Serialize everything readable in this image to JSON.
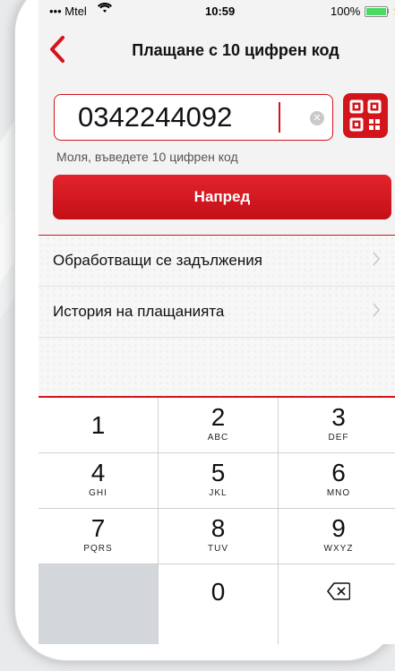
{
  "status": {
    "carrier": "••• Mtel",
    "time": "10:59",
    "battery": "100%"
  },
  "nav": {
    "title": "Плащане с 10 цифрен код"
  },
  "code_input": {
    "value": "0342244092"
  },
  "hint": "Моля, въведете 10 цифрен код",
  "next_button": "Напред",
  "list": [
    {
      "label": "Обработващи се задължения"
    },
    {
      "label": "История на плащанията"
    }
  ],
  "keypad": {
    "k1": {
      "num": "1",
      "letters": ""
    },
    "k2": {
      "num": "2",
      "letters": "ABC"
    },
    "k3": {
      "num": "3",
      "letters": "DEF"
    },
    "k4": {
      "num": "4",
      "letters": "GHI"
    },
    "k5": {
      "num": "5",
      "letters": "JKL"
    },
    "k6": {
      "num": "6",
      "letters": "MNO"
    },
    "k7": {
      "num": "7",
      "letters": "PQRS"
    },
    "k8": {
      "num": "8",
      "letters": "TUV"
    },
    "k9": {
      "num": "9",
      "letters": "WXYZ"
    },
    "k0": {
      "num": "0",
      "letters": ""
    }
  },
  "colors": {
    "accent": "#d4141b",
    "keypad_blank": "#d3d6db"
  },
  "icons": {
    "back": "chevron-left-icon",
    "clear": "clear-circle-icon",
    "qr": "qr-code-icon",
    "chevron": "chevron-right-icon",
    "delete": "backspace-icon"
  }
}
